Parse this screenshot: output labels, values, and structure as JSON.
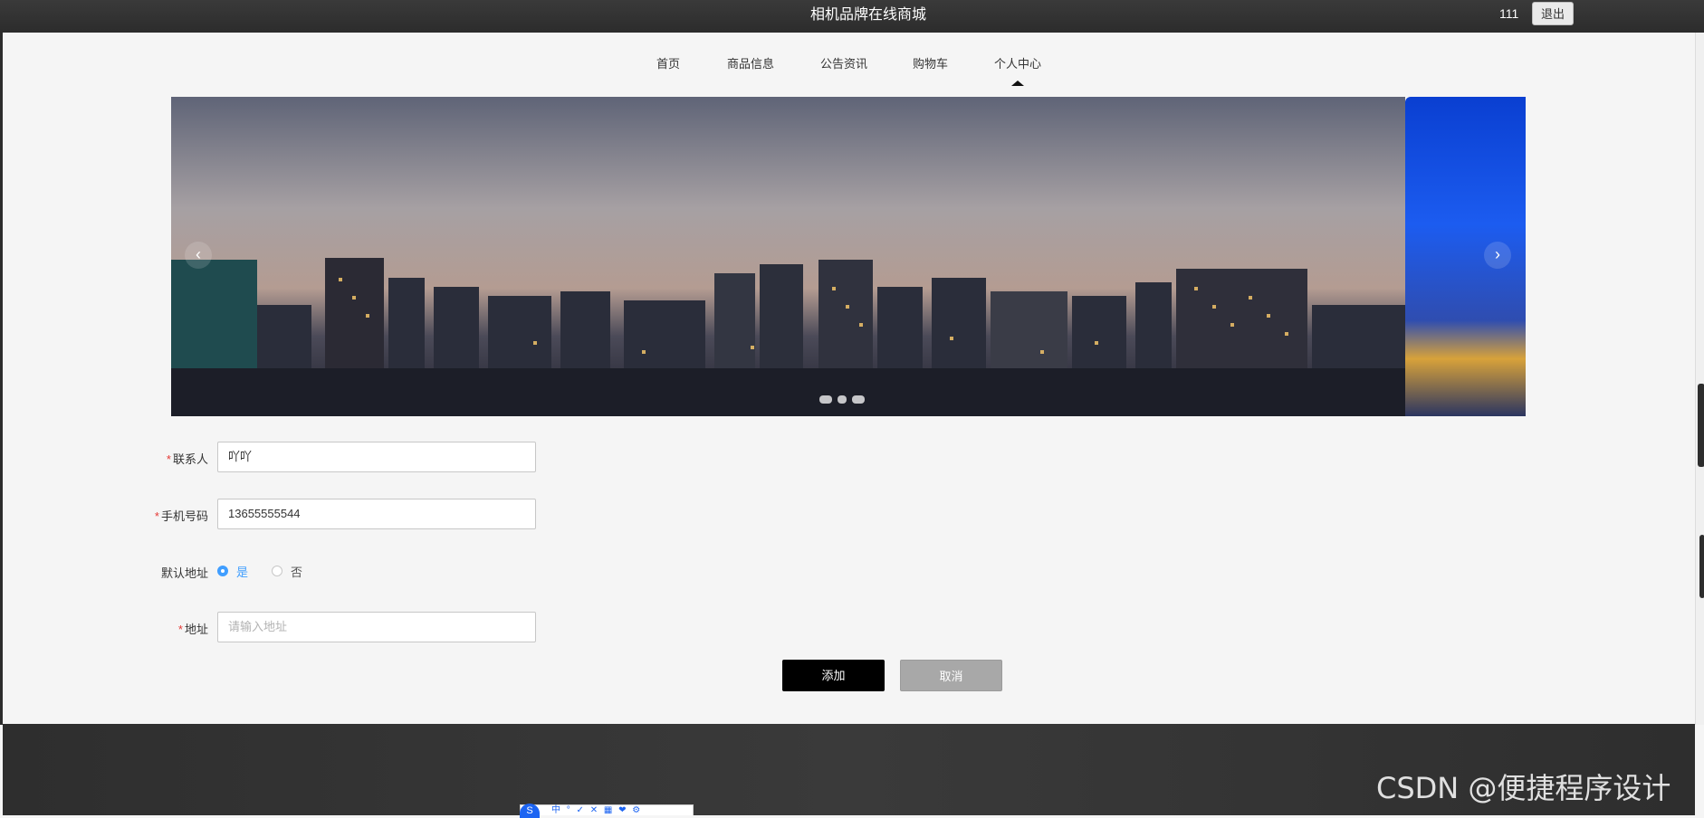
{
  "header": {
    "title": "相机品牌在线商城",
    "username": "111",
    "logout_label": "退出"
  },
  "nav": {
    "items": [
      {
        "label": "首页"
      },
      {
        "label": "商品信息"
      },
      {
        "label": "公告资讯"
      },
      {
        "label": "购物车"
      },
      {
        "label": "个人中心"
      }
    ],
    "active": "个人中心"
  },
  "carousel": {
    "prev_icon": "‹",
    "next_icon": "›",
    "slide_count": 3
  },
  "form": {
    "contact": {
      "label": "联系人",
      "value": "吖吖"
    },
    "phone": {
      "label": "手机号码",
      "value": "13655555544"
    },
    "default_address": {
      "label": "默认地址",
      "options": [
        {
          "label": "是"
        },
        {
          "label": "否"
        }
      ],
      "selected": "是"
    },
    "address": {
      "label": "地址",
      "placeholder": "请输入地址",
      "value": ""
    },
    "required_mark": "*",
    "submit_label": "添加",
    "cancel_label": "取消"
  },
  "watermark": "CSDN @便捷程序设计",
  "ime": {
    "logo": "S",
    "items": "中 ° ✓ ✕ ▦ ❤ ⚙"
  },
  "colors": {
    "topbar": "#2c2c2c",
    "accent_radio": "#409eff",
    "required": "#e53935",
    "submit_bg": "#000000",
    "cancel_bg": "#a8a8a8"
  }
}
